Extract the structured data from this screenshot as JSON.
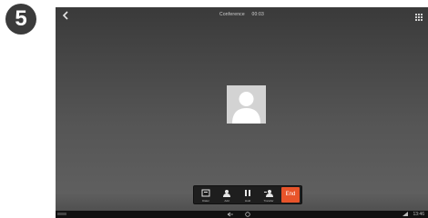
{
  "step_number": "5",
  "header": {
    "title": "Conference",
    "timer": "00:03"
  },
  "toolbar": {
    "buttons": [
      {
        "label": "Dialer",
        "icon": "dialpad-icon"
      },
      {
        "label": "Add",
        "icon": "add-person-icon"
      },
      {
        "label": "Hold",
        "icon": "pause-icon"
      },
      {
        "label": "Transfer",
        "icon": "transfer-icon"
      }
    ],
    "end_label": "End",
    "end_color": "#e8542a"
  },
  "status_bar": {
    "time": "13:46"
  }
}
